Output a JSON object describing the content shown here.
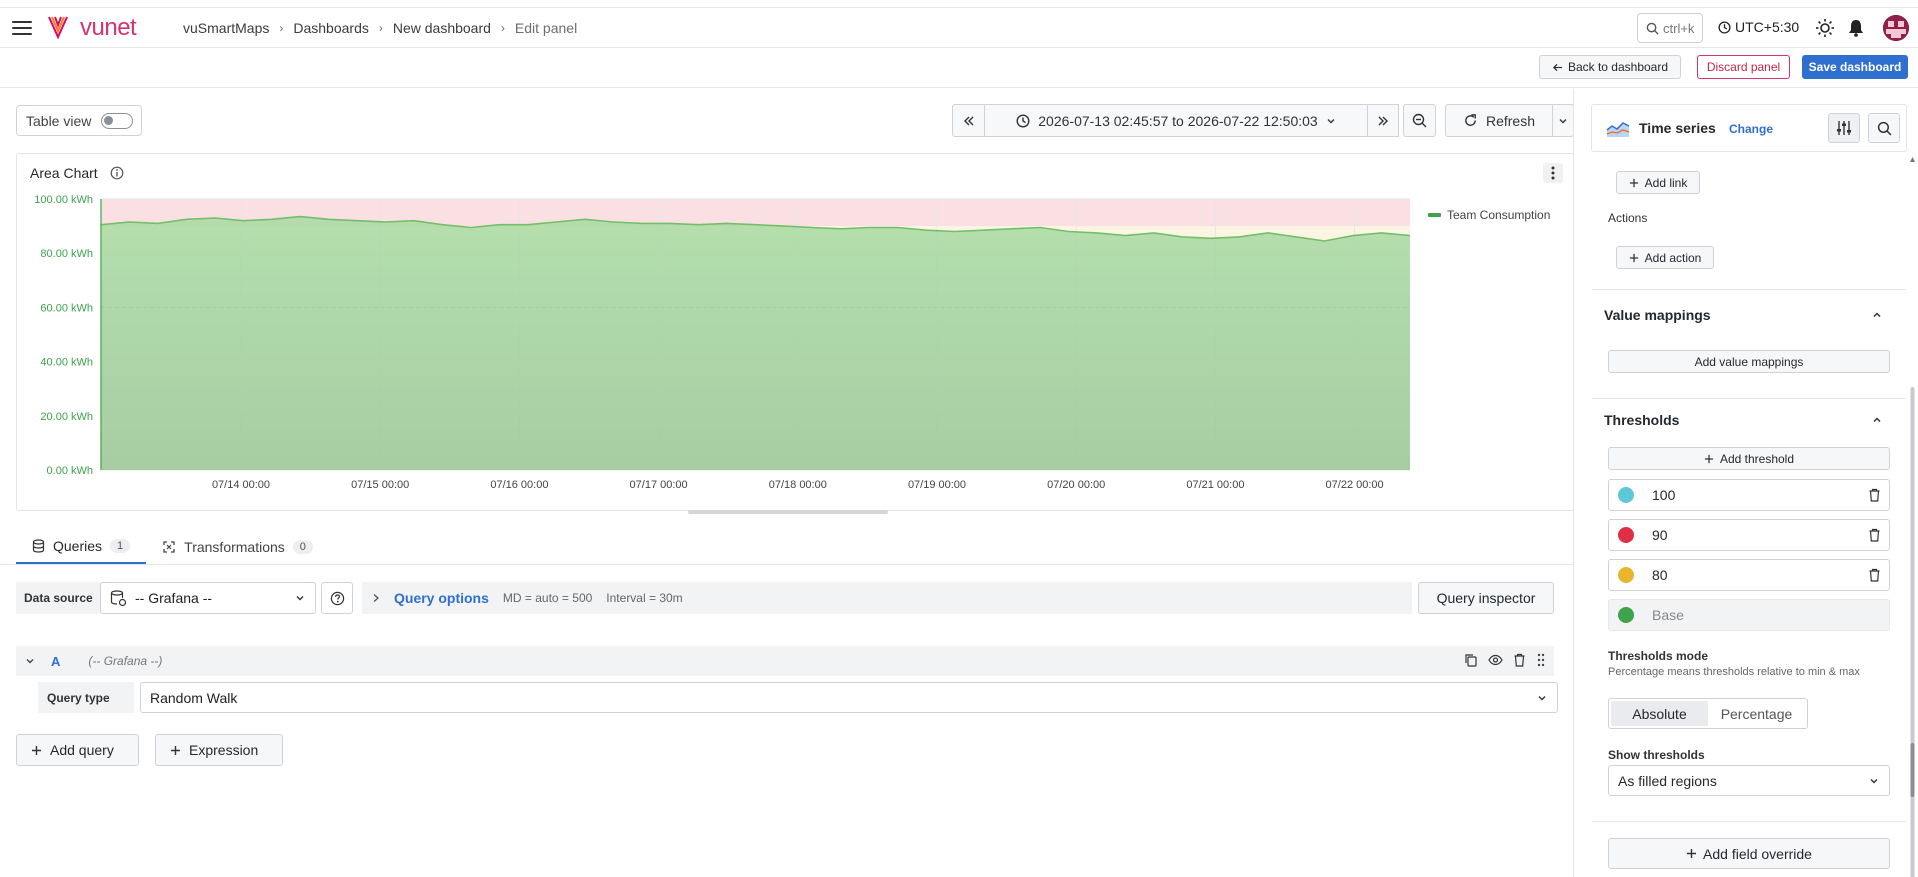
{
  "header": {
    "logo_text": "vunet",
    "breadcrumbs": [
      "vuSmartMaps",
      "Dashboards",
      "New dashboard",
      "Edit panel"
    ],
    "search_placeholder": "ctrl+k",
    "timezone": "UTC+5:30"
  },
  "actionbar": {
    "back_label": "Back to dashboard",
    "discard_label": "Discard panel",
    "save_label": "Save dashboard"
  },
  "toolbar": {
    "table_view_label": "Table view",
    "time_range": "2026-07-13 02:45:57 to 2026-07-22 12:50:03",
    "refresh_label": "Refresh"
  },
  "panel": {
    "title": "Area Chart"
  },
  "chart_data": {
    "type": "area",
    "title": "Area Chart",
    "x_ticks": [
      "07/14 00:00",
      "07/15 00:00",
      "07/16 00:00",
      "07/17 00:00",
      "07/18 00:00",
      "07/19 00:00",
      "07/20 00:00",
      "07/21 00:00",
      "07/22 00:00"
    ],
    "y_ticks": [
      "0.00 kWh",
      "20.00 kWh",
      "40.00 kWh",
      "60.00 kWh",
      "80.00 kWh",
      "100.00 kWh"
    ],
    "ylim": [
      0,
      100
    ],
    "unit": "kWh",
    "series": [
      {
        "name": "Team Consumption",
        "color": "#73bf69",
        "values": [
          90.5,
          91.5,
          91.0,
          92.5,
          93.0,
          92.0,
          92.5,
          93.5,
          92.5,
          92.0,
          91.5,
          92.0,
          90.5,
          89.5,
          90.5,
          90.5,
          91.5,
          92.5,
          91.5,
          91.0,
          91.0,
          90.5,
          91.0,
          90.5,
          90.0,
          89.5,
          89.0,
          89.5,
          89.5,
          88.5,
          88.0,
          88.5,
          89.0,
          89.5,
          88.0,
          87.5,
          86.5,
          87.5,
          86.0,
          85.5,
          86.0,
          87.5,
          86.0,
          84.5,
          86.5,
          87.5,
          86.5
        ]
      }
    ],
    "thresholds": [
      {
        "value": 100,
        "color": "#5ec8d8"
      },
      {
        "value": 90,
        "color": "#e02f44"
      },
      {
        "value": 80,
        "color": "#e8b52c"
      },
      {
        "value": "Base",
        "color": "#3ea34a"
      }
    ],
    "grid": true,
    "legend_position": "top-right"
  },
  "query_tabs": [
    {
      "label": "Queries",
      "count": "1"
    },
    {
      "label": "Transformations",
      "count": "0"
    }
  ],
  "datasource": {
    "label": "Data source",
    "value": "-- Grafana --",
    "query_options_label": "Query options",
    "md_text": "MD = auto = 500",
    "interval_text": "Interval = 30m",
    "inspector_label": "Query inspector"
  },
  "query_a": {
    "ref": "A",
    "ds_hint": "(-- Grafana --)",
    "type_label": "Query type",
    "type_value": "Random Walk"
  },
  "add_query_label": "Add query",
  "expression_label": "Expression",
  "right_panel": {
    "viz_name": "Time series",
    "change_label": "Change",
    "add_link_label": "Add link",
    "actions_title": "Actions",
    "add_action_label": "Add action",
    "value_mappings_title": "Value mappings",
    "add_value_mappings_label": "Add value mappings",
    "thresholds_title": "Thresholds",
    "add_threshold_label": "Add threshold",
    "threshold_values": [
      "100",
      "90",
      "80"
    ],
    "base_label": "Base",
    "thresholds_mode_title": "Thresholds mode",
    "thresholds_mode_desc": "Percentage means thresholds relative to min & max",
    "mode_options": [
      "Absolute",
      "Percentage"
    ],
    "mode_selected": "Absolute",
    "show_thresholds_title": "Show thresholds",
    "show_thresholds_value": "As filled regions",
    "add_override_label": "Add field override"
  }
}
